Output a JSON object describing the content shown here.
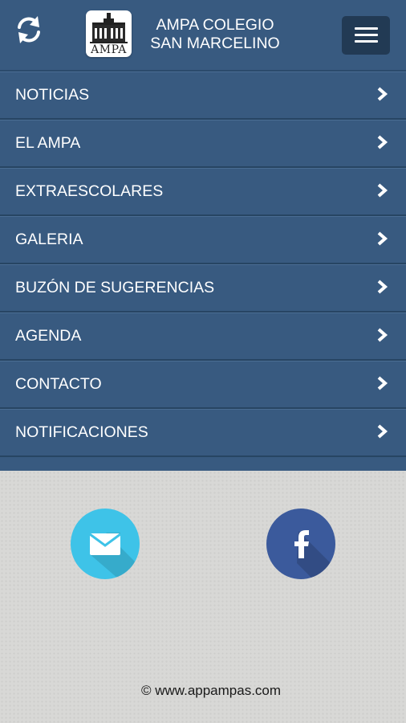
{
  "header": {
    "title_line1": "AMPA COLEGIO",
    "title_line2": "SAN MARCELINO",
    "logo_text": "AMPA",
    "refresh_icon": "refresh-icon",
    "menu_icon": "hamburger-menu-icon"
  },
  "nav": {
    "items": [
      {
        "label": "NOTICIAS"
      },
      {
        "label": "EL AMPA"
      },
      {
        "label": "EXTRAESCOLARES"
      },
      {
        "label": "GALERIA"
      },
      {
        "label": "BUZÓN DE SUGERENCIAS"
      },
      {
        "label": "AGENDA"
      },
      {
        "label": "CONTACTO"
      },
      {
        "label": "NOTIFICACIONES"
      }
    ],
    "chevron_icon": "chevron-right-icon"
  },
  "footer": {
    "email_icon": "envelope-icon",
    "facebook_icon": "facebook-icon",
    "copyright": "© www.appampas.com"
  },
  "colors": {
    "header_bg": "#385a80",
    "menu_button_bg": "#223a54",
    "nav_bg": "#385a80",
    "email_circle": "#3ec3e8",
    "facebook_circle": "#3b5a9c",
    "footer_bg": "#d8d8d6"
  }
}
